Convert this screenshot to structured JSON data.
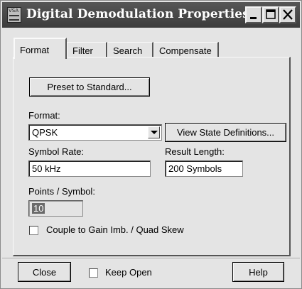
{
  "window": {
    "title": "Digital Demodulation Properties",
    "icon_tag": "VSA"
  },
  "tabs": [
    {
      "label": "Format",
      "active": true
    },
    {
      "label": "Filter",
      "active": false
    },
    {
      "label": "Search",
      "active": false
    },
    {
      "label": "Compensate",
      "active": false
    }
  ],
  "format_panel": {
    "preset_button": "Preset to Standard...",
    "format_label": "Format:",
    "format_value": "QPSK",
    "view_state_button": "View State Definitions...",
    "symbol_rate_label": "Symbol Rate:",
    "symbol_rate_value": "50 kHz",
    "result_length_label": "Result Length:",
    "result_length_value": "200 Symbols",
    "points_per_symbol_label": "Points / Symbol:",
    "points_per_symbol_value": "10",
    "couple_checkbox_label": "Couple to Gain Imb. / Quad Skew",
    "couple_checked": false
  },
  "footer": {
    "close_button": "Close",
    "keep_open_label": "Keep Open",
    "keep_open_checked": false,
    "help_button": "Help"
  },
  "icons": {
    "app": "vsa-app-icon",
    "minimize": "minimize-icon",
    "maximize": "maximize-icon",
    "close": "close-icon",
    "dropdown": "chevron-down-icon"
  }
}
